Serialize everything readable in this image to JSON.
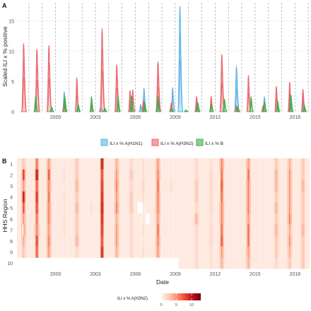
{
  "panels": {
    "a": "A",
    "b": "B"
  },
  "chart_data": [
    {
      "panel": "A",
      "type": "area",
      "ylabel": "Scaled ILI x % positive",
      "xlabel": "",
      "x_ticks": [
        "2000",
        "2003",
        "2006",
        "2009",
        "2012",
        "2015",
        "2018"
      ],
      "y_ticks": [
        "0",
        "5",
        "10",
        "15"
      ],
      "xlim": [
        1997.6,
        2019.6
      ],
      "ylim": [
        0,
        18
      ],
      "season_lines": [
        1998,
        1999,
        2000,
        2001,
        2002,
        2003,
        2004,
        2005,
        2006,
        2007,
        2008,
        2009,
        2010,
        2011,
        2012,
        2013,
        2014,
        2015,
        2016,
        2017,
        2018,
        2019
      ],
      "legend": {
        "placement": "bottom",
        "items": [
          {
            "label": "ILI x % A(H1N1)",
            "color": "#5bb4e5"
          },
          {
            "label": "ILI x % A(H3N2)",
            "color": "#e8646b"
          },
          {
            "label": "ILI x % B",
            "color": "#3fae4a"
          }
        ]
      },
      "series": [
        {
          "name": "ILI x % A(H1N1)",
          "color": "#5bb4e5",
          "peaks": [
            {
              "t": 2001.15,
              "y": 3.3
            },
            {
              "t": 2003.9,
              "y": 0.8
            },
            {
              "t": 2006.9,
              "y": 1.2
            },
            {
              "t": 2007.15,
              "y": 3.9
            },
            {
              "t": 2008.2,
              "y": 2.0
            },
            {
              "t": 2009.3,
              "y": 4.0
            },
            {
              "t": 2009.85,
              "y": 17.5
            },
            {
              "t": 2011.1,
              "y": 2.0
            },
            {
              "t": 2014.1,
              "y": 7.5
            },
            {
              "t": 2016.2,
              "y": 2.5
            },
            {
              "t": 2018.1,
              "y": 2.8
            },
            {
              "t": 2019.1,
              "y": 3.2
            }
          ]
        },
        {
          "name": "ILI x % A(H3N2)",
          "color": "#e8646b",
          "peaks": [
            {
              "t": 1998.1,
              "y": 11.3
            },
            {
              "t": 1999.1,
              "y": 10.4
            },
            {
              "t": 2000.0,
              "y": 11.0
            },
            {
              "t": 2001.15,
              "y": 1.8
            },
            {
              "t": 2002.1,
              "y": 5.6
            },
            {
              "t": 2003.2,
              "y": 1.0
            },
            {
              "t": 2004.0,
              "y": 13.8
            },
            {
              "t": 2005.1,
              "y": 7.8
            },
            {
              "t": 2006.1,
              "y": 3.5
            },
            {
              "t": 2006.3,
              "y": 3.6
            },
            {
              "t": 2007.1,
              "y": 1.9
            },
            {
              "t": 2008.2,
              "y": 8.3
            },
            {
              "t": 2009.2,
              "y": 1.5
            },
            {
              "t": 2011.1,
              "y": 2.6
            },
            {
              "t": 2012.2,
              "y": 2.6
            },
            {
              "t": 2013.0,
              "y": 9.5
            },
            {
              "t": 2014.1,
              "y": 1.0
            },
            {
              "t": 2015.0,
              "y": 6.0
            },
            {
              "t": 2016.1,
              "y": 1.0
            },
            {
              "t": 2017.1,
              "y": 4.2
            },
            {
              "t": 2018.1,
              "y": 4.9
            },
            {
              "t": 2019.1,
              "y": 3.7
            }
          ]
        },
        {
          "name": "ILI x % B",
          "color": "#3fae4a",
          "peaks": [
            {
              "t": 1999.0,
              "y": 2.5
            },
            {
              "t": 2000.2,
              "y": 0.8
            },
            {
              "t": 2001.2,
              "y": 2.6
            },
            {
              "t": 2002.2,
              "y": 1.3
            },
            {
              "t": 2003.2,
              "y": 2.5
            },
            {
              "t": 2004.2,
              "y": 0.6
            },
            {
              "t": 2005.2,
              "y": 2.6
            },
            {
              "t": 2006.2,
              "y": 2.6
            },
            {
              "t": 2007.2,
              "y": 1.6
            },
            {
              "t": 2008.2,
              "y": 2.6
            },
            {
              "t": 2009.2,
              "y": 0.5
            },
            {
              "t": 2010.3,
              "y": 0.3
            },
            {
              "t": 2011.2,
              "y": 1.5
            },
            {
              "t": 2012.2,
              "y": 1.2
            },
            {
              "t": 2013.2,
              "y": 2.1
            },
            {
              "t": 2014.2,
              "y": 0.8
            },
            {
              "t": 2015.2,
              "y": 2.5
            },
            {
              "t": 2016.2,
              "y": 1.6
            },
            {
              "t": 2017.2,
              "y": 1.8
            },
            {
              "t": 2018.2,
              "y": 2.8
            },
            {
              "t": 2019.2,
              "y": 1.1
            }
          ]
        }
      ]
    },
    {
      "panel": "B",
      "type": "heatmap",
      "xlabel": "Date",
      "ylabel": "HHS Region",
      "x_ticks": [
        "2000",
        "2003",
        "2006",
        "2009",
        "2012",
        "2015",
        "2018"
      ],
      "y_ticks": [
        "1",
        "2",
        "3",
        "4",
        "5",
        "6",
        "7",
        "8",
        "9",
        "10"
      ],
      "xlim": [
        1997.6,
        2019.6
      ],
      "region10_start": 2009.75,
      "legend": {
        "title": "ILI x % A(H3N2)",
        "ticks": [
          "0",
          "5",
          "10"
        ],
        "range": [
          0,
          13
        ],
        "colors": [
          "#fff5f0",
          "#fcbba1",
          "#fb6a4a",
          "#cb181d",
          "#67000d"
        ]
      },
      "missing_cells": [
        {
          "region": 5,
          "t0": 2006.65,
          "t1": 2007.05
        },
        {
          "region": 6,
          "t0": 2007.3,
          "t1": 2007.55
        },
        {
          "region": 7,
          "t0": 1998.0,
          "t1": 1998.1
        }
      ],
      "seasons": [
        {
          "t": 1998.1,
          "values": [
            3,
            9,
            5,
            11,
            8,
            5,
            6,
            4,
            3,
            0
          ]
        },
        {
          "t": 1999.1,
          "values": [
            7,
            12,
            8,
            10,
            9,
            7,
            6,
            9,
            8,
            0
          ]
        },
        {
          "t": 2000.0,
          "values": [
            5,
            8,
            6,
            7,
            6,
            6,
            5,
            6,
            5,
            0
          ]
        },
        {
          "t": 2001.15,
          "values": [
            1,
            1.5,
            1,
            1.5,
            1,
            1.5,
            1.5,
            1,
            1,
            0
          ]
        },
        {
          "t": 2002.1,
          "values": [
            3,
            3,
            4,
            3,
            4,
            3,
            3,
            4,
            2,
            0
          ]
        },
        {
          "t": 2003.2,
          "values": [
            1,
            1,
            1,
            1,
            1.5,
            1,
            1,
            1,
            1,
            0
          ]
        },
        {
          "t": 2004.0,
          "values": [
            12,
            9,
            10,
            11,
            12,
            11,
            10,
            9,
            11,
            0
          ]
        },
        {
          "t": 2005.1,
          "values": [
            4,
            5,
            6,
            5,
            6,
            4,
            5,
            5,
            4,
            0
          ]
        },
        {
          "t": 2006.2,
          "values": [
            2,
            3,
            2,
            3,
            3,
            2,
            2,
            2,
            2,
            0
          ]
        },
        {
          "t": 2007.1,
          "values": [
            1.5,
            1.5,
            2,
            1.5,
            1,
            1,
            1.5,
            1,
            1.5,
            0
          ]
        },
        {
          "t": 2008.2,
          "values": [
            5,
            6,
            7,
            6,
            6,
            5,
            7,
            6,
            5,
            0
          ]
        },
        {
          "t": 2009.2,
          "values": [
            1,
            1,
            1.5,
            1,
            1,
            1,
            1,
            1,
            1,
            0
          ]
        },
        {
          "t": 2011.1,
          "values": [
            2,
            2,
            3,
            3,
            2,
            4,
            2,
            2,
            2,
            2
          ]
        },
        {
          "t": 2012.2,
          "values": [
            1.5,
            2,
            2,
            2,
            2,
            1.5,
            2,
            2,
            1.5,
            1.5
          ]
        },
        {
          "t": 2013.0,
          "values": [
            6,
            7,
            8,
            7,
            6,
            6,
            7,
            8,
            5,
            4
          ]
        },
        {
          "t": 2014.1,
          "values": [
            1,
            1,
            1,
            1,
            1,
            1,
            1,
            1,
            1,
            1
          ]
        },
        {
          "t": 2015.0,
          "values": [
            5,
            7,
            6,
            6,
            6,
            5,
            7,
            7,
            5,
            4
          ]
        },
        {
          "t": 2016.1,
          "values": [
            1,
            1,
            1,
            1,
            1,
            1,
            1,
            1,
            1,
            1
          ]
        },
        {
          "t": 2017.1,
          "values": [
            3,
            4,
            4,
            3,
            4,
            3,
            4,
            3,
            3,
            2
          ]
        },
        {
          "t": 2018.1,
          "values": [
            4,
            5,
            5,
            5,
            5,
            6,
            4,
            5,
            4,
            3
          ]
        },
        {
          "t": 2019.1,
          "values": [
            3,
            3,
            4,
            3,
            3,
            3,
            4,
            3,
            3,
            3
          ]
        }
      ]
    }
  ]
}
